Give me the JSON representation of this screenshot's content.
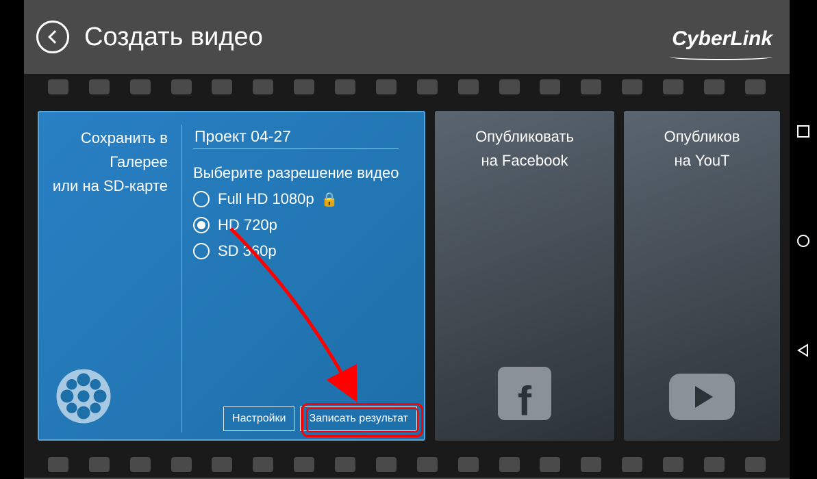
{
  "header": {
    "title": "Создать видео",
    "logo": "CyberLink"
  },
  "save_card": {
    "line1": "Сохранить в",
    "line2": "Галерее",
    "line3": "или на SD-карте",
    "project_value": "Проект 04-27",
    "resolution_label": "Выберите разрешение видео",
    "options": {
      "fullhd": "Full HD 1080p",
      "hd": "HD 720p",
      "sd": "SD 360p"
    },
    "settings_btn": "Настройки",
    "record_btn": "Записать результат"
  },
  "publish_fb": {
    "line1": "Опубликовать",
    "line2": "на Facebook"
  },
  "publish_yt": {
    "line1": "Опубликов",
    "line2": "на YouT"
  }
}
